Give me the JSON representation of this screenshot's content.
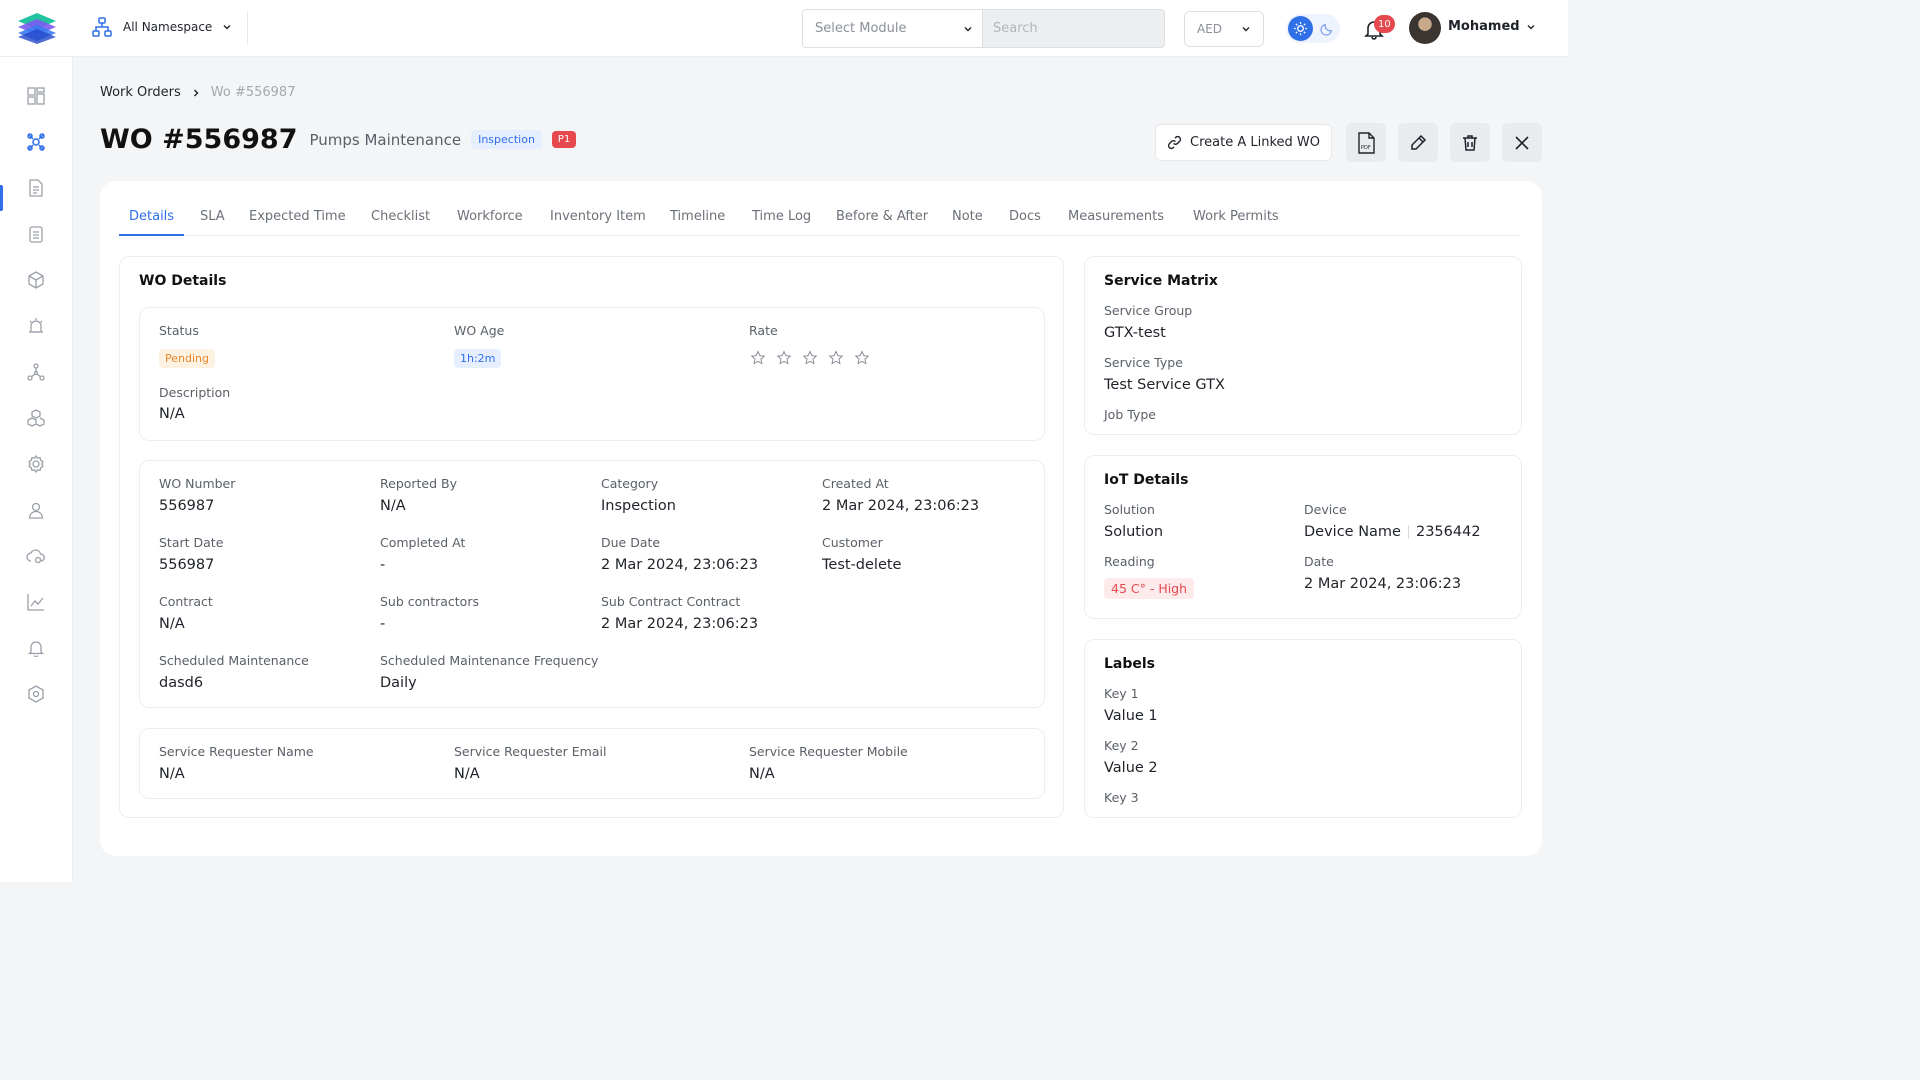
{
  "topbar": {
    "namespace": "All Namespace",
    "module_placeholder": "Select Module",
    "search_placeholder": "Search",
    "currency": "AED",
    "notifications_count": "10",
    "user_name": "Mohamed"
  },
  "breadcrumb": {
    "parent": "Work Orders",
    "current": "Wo #556987"
  },
  "header": {
    "title": "WO #556987",
    "subtitle": "Pumps Maintenance",
    "type_badge": "Inspection",
    "priority_badge": "P1",
    "create_linked_label": "Create A Linked WO"
  },
  "tabs": [
    "Details",
    "SLA",
    "Expected Time",
    "Checklist",
    "Workforce",
    "Inventory Item",
    "Timeline",
    "Time Log",
    "Before & After",
    "Note",
    "Docs",
    "Measurements",
    "Work Permits"
  ],
  "wo_details": {
    "title": "WO Details",
    "status_label": "Status",
    "status_value": "Pending",
    "age_label": "WO Age",
    "age_value": "1h:2m",
    "rate_label": "Rate",
    "rating": 0,
    "rating_max": 5,
    "description_label": "Description",
    "description_value": "N/A",
    "fields": [
      {
        "label": "WO Number",
        "value": "556987"
      },
      {
        "label": "Reported By",
        "value": "N/A"
      },
      {
        "label": "Category",
        "value": "Inspection"
      },
      {
        "label": "Created At",
        "value": "2 Mar 2024, 23:06:23"
      },
      {
        "label": "Start Date",
        "value": "556987"
      },
      {
        "label": "Completed At",
        "value": "-"
      },
      {
        "label": "Due Date",
        "value": "2 Mar 2024, 23:06:23"
      },
      {
        "label": "Customer",
        "value": "Test-delete"
      },
      {
        "label": "Contract",
        "value": "N/A"
      },
      {
        "label": "Sub contractors",
        "value": "-"
      },
      {
        "label": "Sub Contract Contract",
        "value": "2 Mar 2024, 23:06:23"
      },
      {
        "label": "Scheduled Maintenance",
        "value": "dasd6"
      },
      {
        "label": "Scheduled Maintenance Frequency",
        "value": "Daily"
      }
    ],
    "requester": [
      {
        "label": "Service Requester Name",
        "value": "N/A"
      },
      {
        "label": "Service Requester Email",
        "value": "N/A"
      },
      {
        "label": "Service Requester Mobile",
        "value": "N/A"
      }
    ]
  },
  "service_matrix": {
    "title": "Service Matrix",
    "group_label": "Service Group",
    "group_value": "GTX-test",
    "type_label": "Service Type",
    "type_value": "Test Service GTX",
    "job_type_label": "Job Type"
  },
  "iot": {
    "title": "IoT Details",
    "solution_label": "Solution",
    "solution_value": "Solution",
    "device_label": "Device",
    "device_name": "Device Name",
    "device_id": "2356442",
    "reading_label": "Reading",
    "reading_value": "45 C° - High",
    "date_label": "Date",
    "date_value": "2 Mar 2024, 23:06:23"
  },
  "labels": {
    "title": "Labels",
    "items": [
      {
        "key": "Key 1",
        "value": "Value 1"
      },
      {
        "key": "Key 2",
        "value": "Value 2"
      },
      {
        "key": "Key 3",
        "value": ""
      }
    ]
  },
  "colors": {
    "accent": "#2f6fe8",
    "danger": "#e5484d",
    "pending": "#e78a2a"
  }
}
